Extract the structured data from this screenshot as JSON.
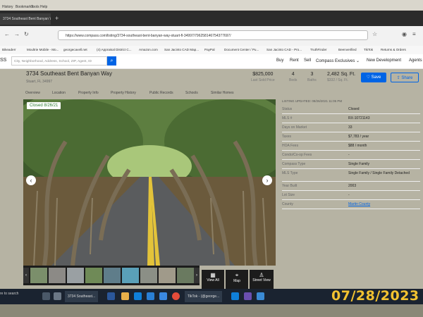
{
  "menubar": {
    "items": [
      "History",
      "Bookmarks",
      "Tools",
      "Help"
    ]
  },
  "browser": {
    "tab_title": "3734 Southeast Bent Banyan W...",
    "url": "https://www.compass.com/listing/3734-southeast-bent-banyan-way-stuart-fl-34997/796258146754377697/"
  },
  "bookmarks": [
    "Bikeaderr",
    "Moultrie Mobile - Mo...",
    "georgecavell.net",
    "(4) Appraisal District C...",
    "Amazon.com",
    "San Jacinto CAD Map...",
    "PayPal",
    "Document Center / Pu...",
    "San Jacinto CAD - Pro...",
    "TruthFinder",
    "Beenverified",
    "TikTok",
    "Returns & Orders"
  ],
  "header": {
    "logo_fragment": "SS",
    "search_placeholder": "City, Neighborhood, Address, School, ZIP, Agent, ID",
    "nav": [
      "Buy",
      "Rent",
      "Sell",
      "Compass Exclusives ⌄",
      "New Development",
      "Agents"
    ]
  },
  "property": {
    "address": "3734 Southeast Bent Banyan Way",
    "city": "Stuart, FL 34997",
    "price": "$825,000",
    "price_label": "Last Sold Price",
    "beds": "4",
    "beds_label": "Beds",
    "baths": "3",
    "baths_label": "Baths",
    "sqft": "2,482 Sq. Ft.",
    "price_per_sqft": "$332 / Sq. Ft.",
    "save_label": "Save",
    "share_label": "Share"
  },
  "subnav": [
    "Overview",
    "Location",
    "Property Info",
    "Property History",
    "Public Records",
    "Schools",
    "Similar Homes"
  ],
  "photo": {
    "badge": "Closed 8/26/21",
    "view_all": "View All",
    "map": "Map",
    "street_view": "Street View"
  },
  "facts": {
    "updated": "LISTING UPDATED: 08/26/2021 11:05 PM",
    "rows": [
      {
        "k": "Status",
        "v": "Closed"
      },
      {
        "k": "MLS #",
        "v": "RX-10721143"
      },
      {
        "k": "Days on Market",
        "v": "33"
      },
      {
        "k": "Taxes",
        "v": "$7,783 / year"
      },
      {
        "k": "HOA Fees",
        "v": "$88 / month"
      },
      {
        "k": "Condo/Co-op Fees",
        "v": "-"
      },
      {
        "k": "Compass Type",
        "v": "Single Family"
      },
      {
        "k": "MLS Type",
        "v": "Single Family / Single Family Detached"
      },
      {
        "k": "Year Built",
        "v": "2003"
      },
      {
        "k": "Lot Size",
        "v": "-"
      },
      {
        "k": "County",
        "v": "Martin County"
      }
    ]
  },
  "taskbar": {
    "search": "re to search",
    "app1": "3734 Southeast...",
    "app2": "TikTok - (@george..."
  },
  "stamp": "07/28/2023",
  "colors": {
    "accent": "#0064e5",
    "closed": "#2e7d32",
    "stamp": "#f2c230"
  }
}
